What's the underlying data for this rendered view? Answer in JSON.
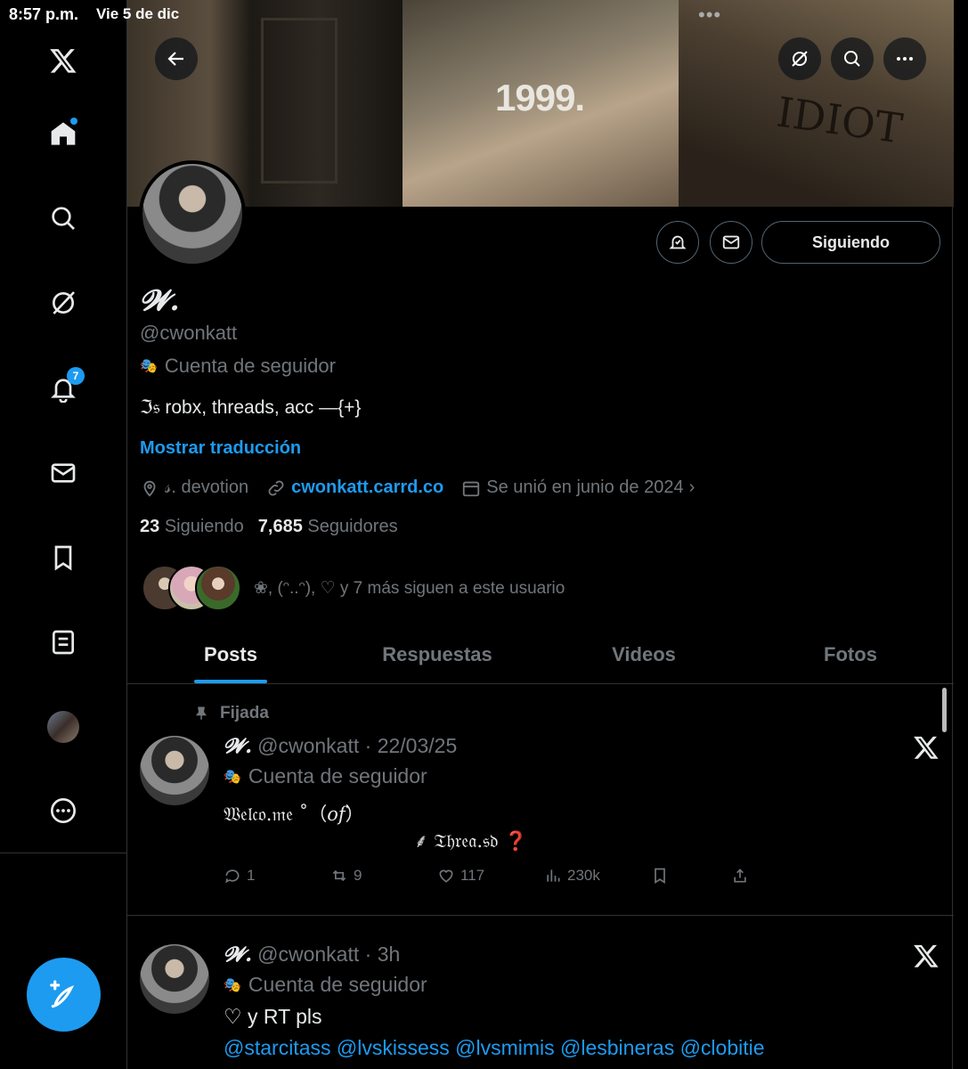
{
  "status_bar": {
    "time": "8:57 p.m.",
    "date": "Vie 5 de dic"
  },
  "sidebar": {
    "notifications_count": "7",
    "items": [
      "x-logo",
      "home",
      "explore",
      "grok",
      "notifications",
      "messages",
      "bookmarks",
      "lists",
      "profile",
      "more"
    ]
  },
  "banner": {
    "text_middle": "1999.",
    "text_right": "IDIOT"
  },
  "profile": {
    "display_name": "𝓦.",
    "handle": "@cwonkatt",
    "follower_label": "Cuenta de seguidor",
    "bio": "ℑ𝔰 robx, threads, acc —{+}",
    "translate": "Mostrar traducción",
    "location": "𝓈. devotion",
    "link": "cwonkatt.carrd.co",
    "joined": "Se unió en junio de 2024",
    "following_count": "23",
    "following_label": "Siguiendo",
    "followers_count": "7,685",
    "followers_label": "Seguidores",
    "followed_by": "❀, (ᵔ..ᵔ), ♡ y 7 más siguen a este usuario",
    "follow_button": "Siguiendo"
  },
  "tabs": [
    {
      "label": "Posts",
      "active": true
    },
    {
      "label": "Respuestas",
      "active": false
    },
    {
      "label": "Videos",
      "active": false
    },
    {
      "label": "Fotos",
      "active": false
    }
  ],
  "posts": [
    {
      "pinned": "Fijada",
      "name": "𝓦.",
      "handle": "@cwonkatt",
      "time": "22/03/25",
      "sub": "Cuenta de seguidor",
      "line1": "𝔚𝔢𝔩𝔠𝔬.𝔪𝔢 ˚（𝑜𝑓）",
      "line2": "⸙ 𝔗𝔥𝔯𝔢𝔞.𝔰𝔡 ❓",
      "replies": "1",
      "reposts": "9",
      "likes": "117",
      "views": "230k"
    },
    {
      "name": "𝓦.",
      "handle": "@cwonkatt",
      "time": "3h",
      "sub": "Cuenta de seguidor",
      "line1": "♡ y RT pls",
      "mentions": "@starcitass @lvskissess @lvsmimis @lesbineras @clobitie"
    }
  ],
  "colors": {
    "accent": "#1d9bf0",
    "background": "#000000",
    "muted": "#71767b",
    "text": "#e7e9ea",
    "border": "#2f3336"
  }
}
